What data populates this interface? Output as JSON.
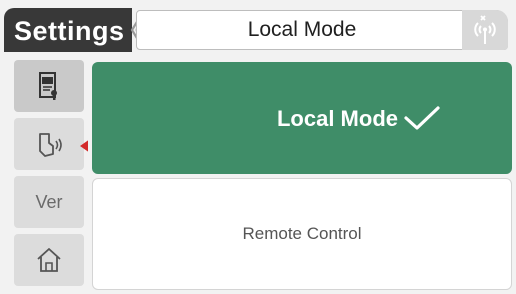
{
  "header": {
    "title": "Settings",
    "current_mode": "Local Mode",
    "signal_icon": "wireless-signal-icon"
  },
  "sidebar": {
    "items": [
      {
        "name": "settings-document",
        "icon": "settings-document-icon",
        "active": true
      },
      {
        "name": "voice-control",
        "icon": "hand-sound-icon",
        "active": false
      },
      {
        "name": "version",
        "label": "Ver",
        "active": false
      },
      {
        "name": "home",
        "icon": "home-icon",
        "active": false
      }
    ]
  },
  "options": [
    {
      "label": "Local Mode",
      "selected": true
    },
    {
      "label": "Remote Control",
      "selected": false
    }
  ],
  "colors": {
    "accent": "#3f8d68",
    "header_tab": "#383838",
    "marker": "#d32a2a"
  }
}
